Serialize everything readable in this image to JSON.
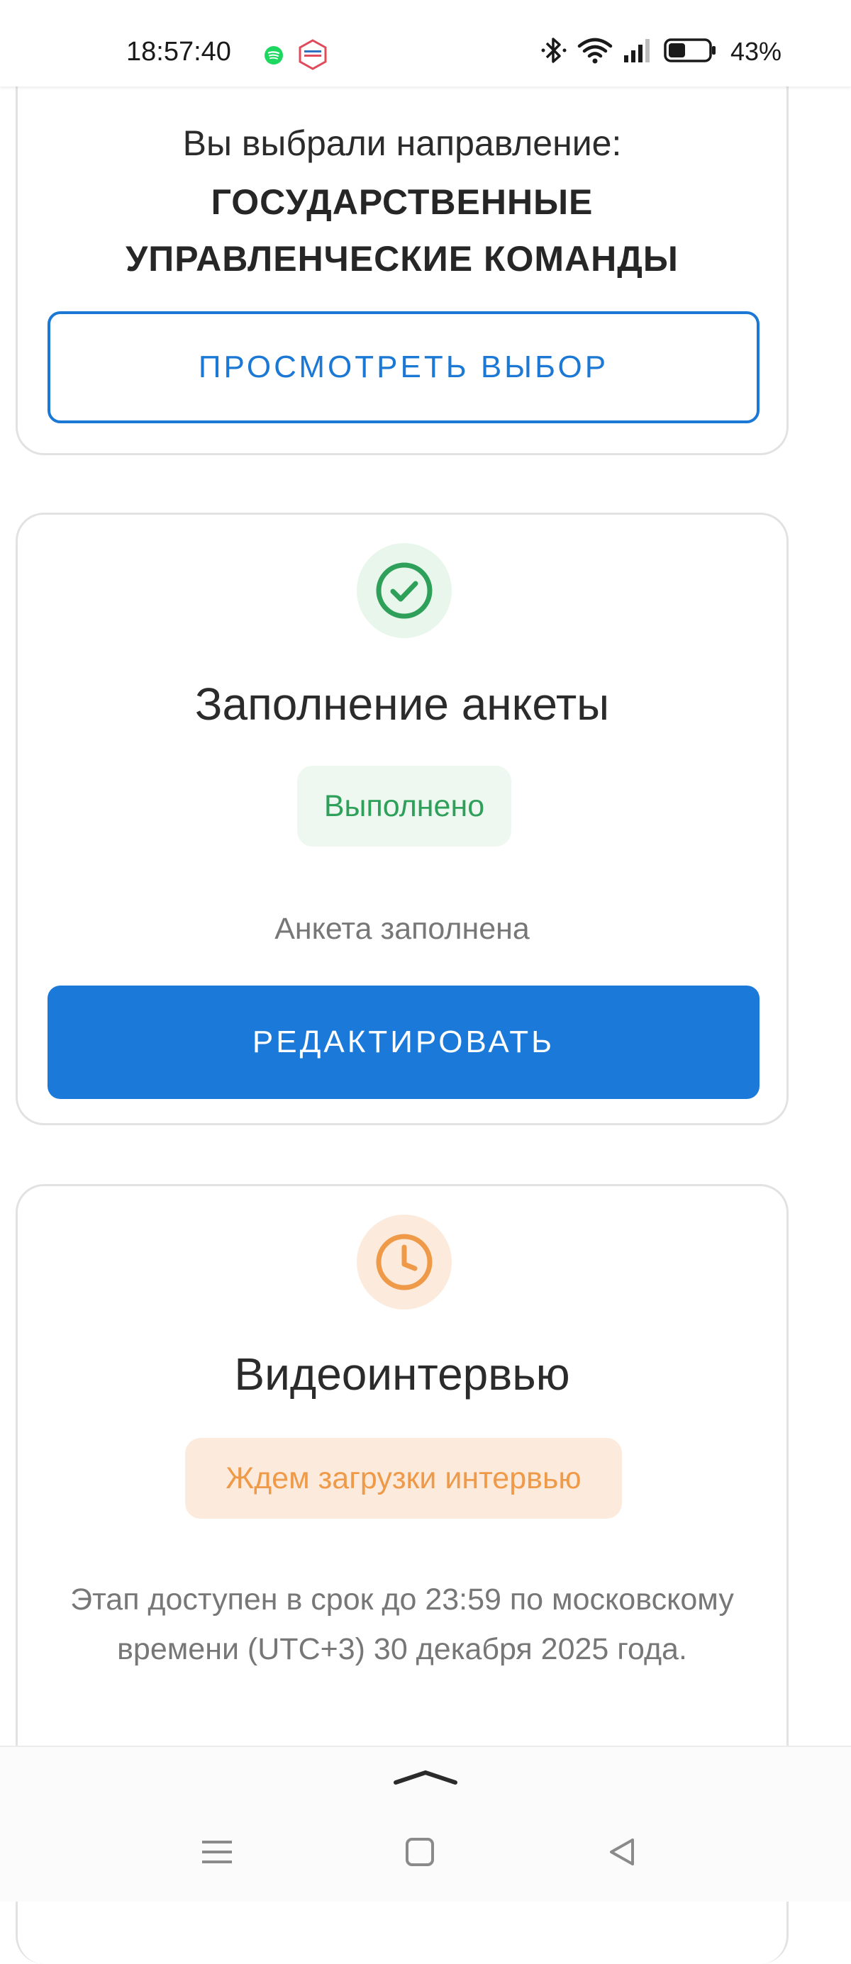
{
  "status_bar": {
    "time": "18:57:40",
    "battery_percent": "43%",
    "icons": [
      "spotify-icon",
      "gosuslugi-icon",
      "bluetooth-icon",
      "wifi-icon",
      "signal-icon",
      "battery-icon"
    ],
    "battery_level": 0.43
  },
  "direction_card": {
    "label": "Вы выбрали направление:",
    "value": "ГОСУДАРСТВЕННЫЕ УПРАВЛЕНЧЕСКИЕ КОМАНДЫ",
    "button_label": "ПРОСМОТРЕТЬ ВЫБОР"
  },
  "questionnaire_card": {
    "icon": "check-circle-icon",
    "title": "Заполнение анкеты",
    "status": "Выполнено",
    "note": "Анкета заполнена",
    "button_label": "РЕДАКТИРОВАТЬ"
  },
  "interview_card": {
    "icon": "clock-icon",
    "title": "Видеоинтервью",
    "status": "Ждем загрузки интервью",
    "note": "Этап доступен в срок до 23:59 по московскому времени (UTC+3) 30 декабря 2025 года."
  },
  "colors": {
    "primary": "#1b7ad9",
    "success": "#2ea05a",
    "success_bg": "#eef8f1",
    "warning": "#ef9a48",
    "warning_bg": "#fcebdc"
  },
  "navigation": {
    "icons": [
      "sheet-handle-icon",
      "menu-icon",
      "home-icon",
      "back-icon"
    ]
  }
}
